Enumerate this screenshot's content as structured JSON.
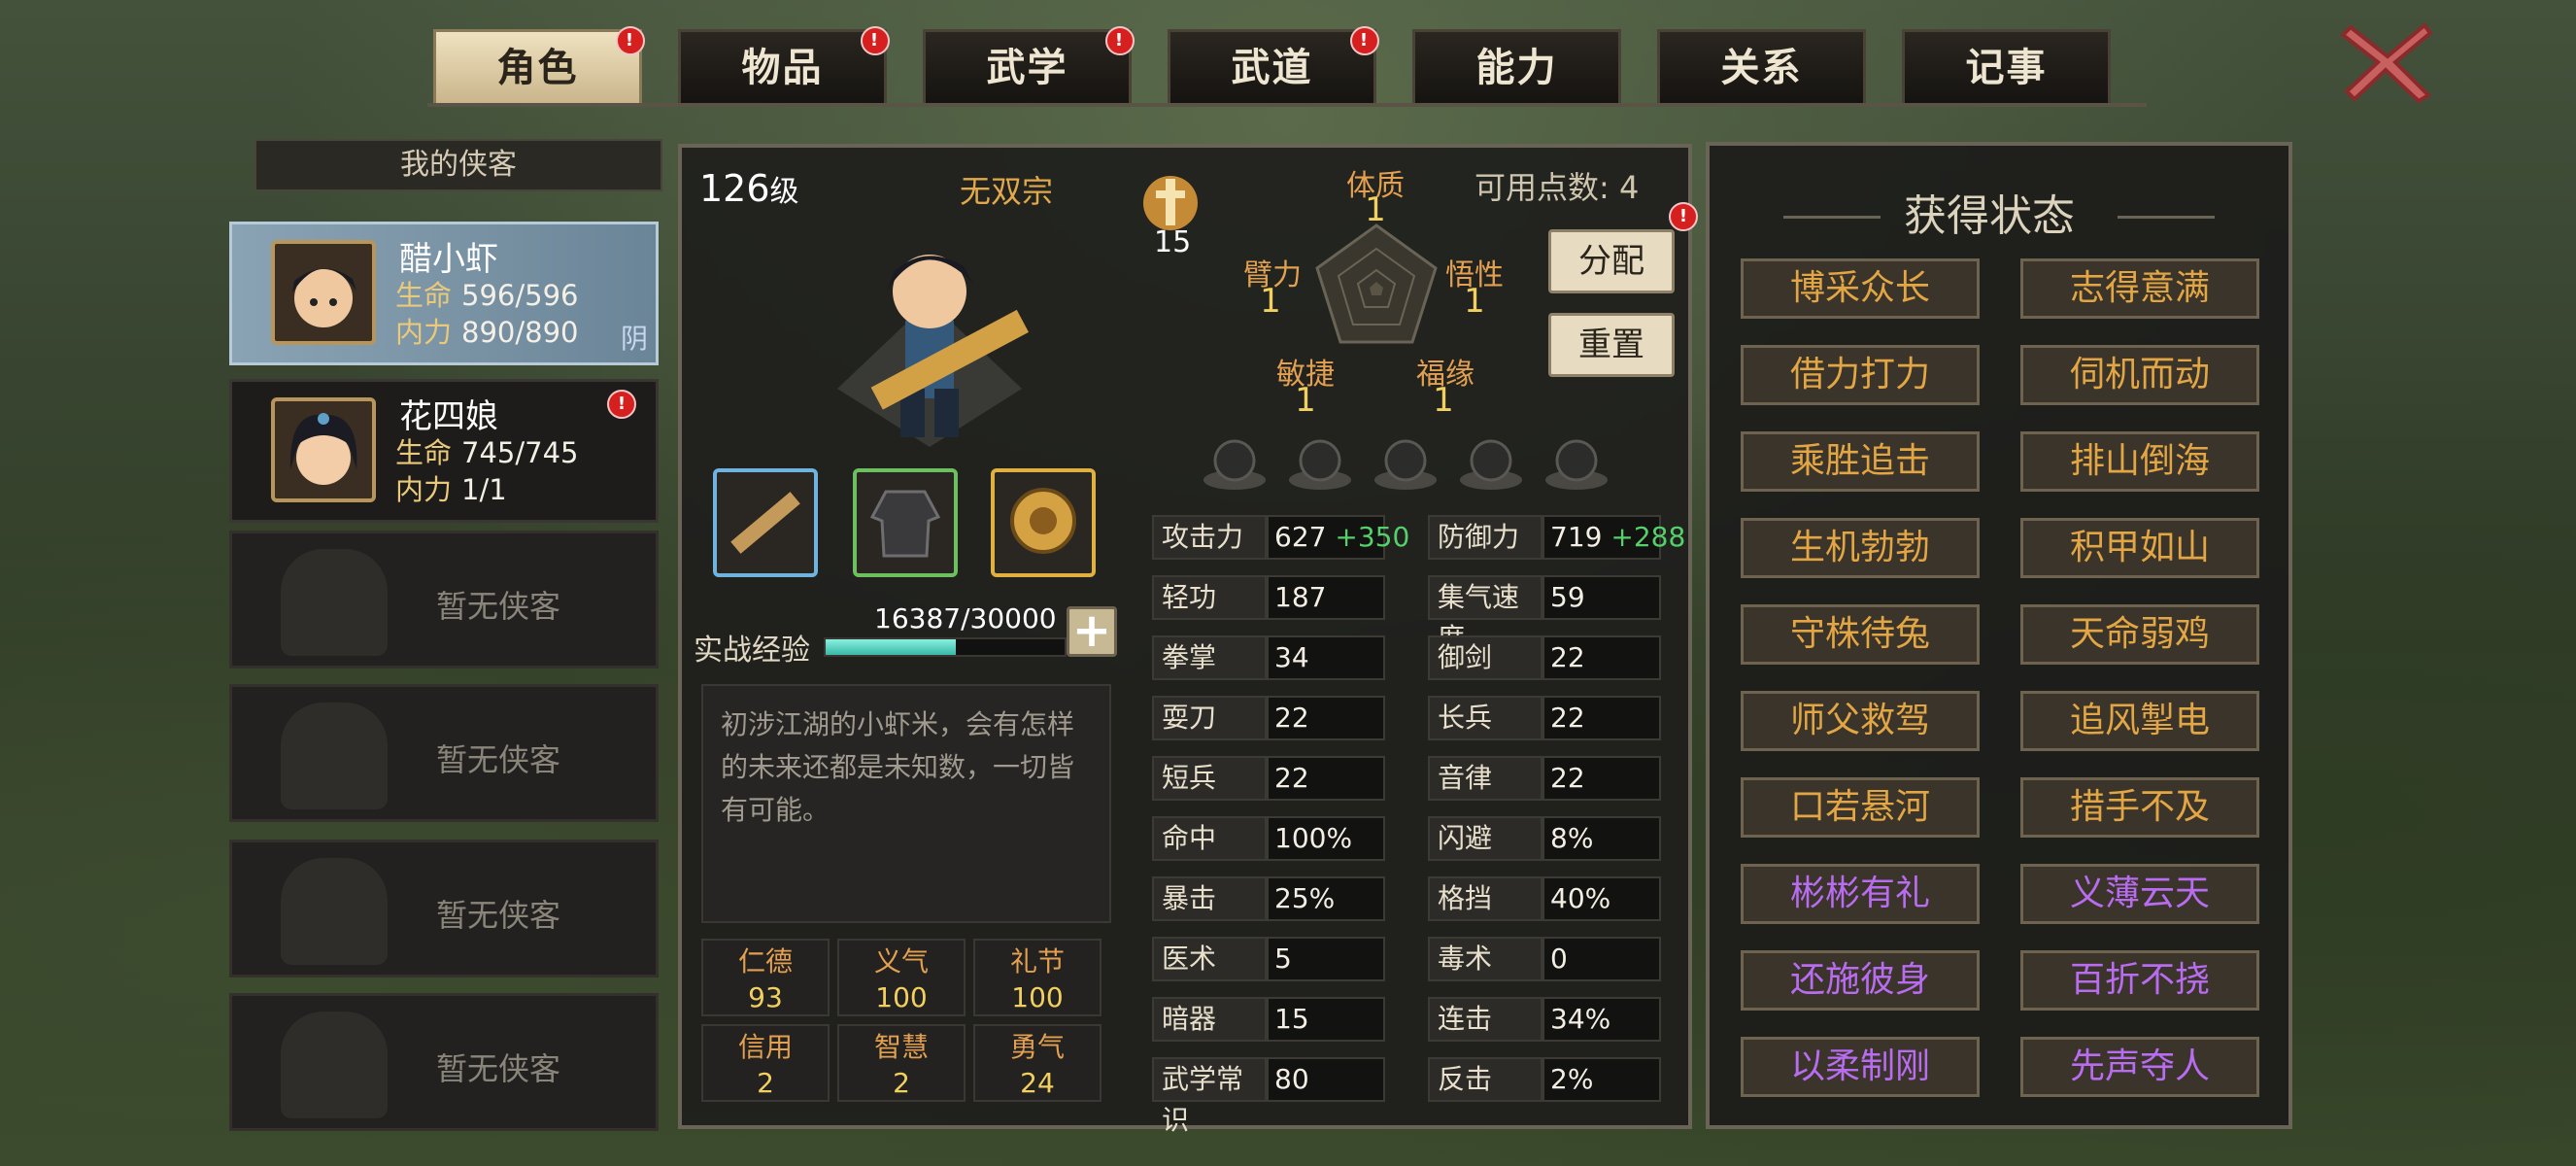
{
  "tabs": [
    {
      "label": "角色",
      "active": true,
      "alert": true
    },
    {
      "label": "物品",
      "active": false,
      "alert": true
    },
    {
      "label": "武学",
      "active": false,
      "alert": true
    },
    {
      "label": "武道",
      "active": false,
      "alert": true
    },
    {
      "label": "能力",
      "active": false,
      "alert": false
    },
    {
      "label": "关系",
      "active": false,
      "alert": false
    },
    {
      "label": "记事",
      "active": false,
      "alert": false
    }
  ],
  "alert_glyph": "!",
  "list_header": "我的侠客",
  "characters": [
    {
      "name": "醋小虾",
      "hp_label": "生命",
      "hp": "596/596",
      "mp_label": "内力",
      "mp": "890/890",
      "tag": "阴"
    },
    {
      "name": "花四娘",
      "hp_label": "生命",
      "hp": "745/745",
      "mp_label": "内力",
      "mp": "1/1"
    }
  ],
  "empty_slot": "暂无侠客",
  "profile": {
    "level": "126",
    "level_unit": "级",
    "sect": "无双宗",
    "count": "15",
    "points_label": "可用点数: 4",
    "attrs": {
      "tizhi": "体质",
      "tizhi_v": "1",
      "bili": "臂力",
      "bili_v": "1",
      "wuxing": "悟性",
      "wuxing_v": "1",
      "minjie": "敏捷",
      "minjie_v": "1",
      "fuyuan": "福缘",
      "fuyuan_v": "1"
    },
    "assign_btn": "分配",
    "reset_btn": "重置",
    "exp_label": "实战经验",
    "exp_value": "16387/30000",
    "exp_ratio": 0.546,
    "plus": "+",
    "description": "初涉江湖的小虾米，会有怎样的未来还都是未知数，一切皆有可能。"
  },
  "virtues": [
    {
      "label": "仁德",
      "value": "93"
    },
    {
      "label": "义气",
      "value": "100"
    },
    {
      "label": "礼节",
      "value": "100"
    },
    {
      "label": "信用",
      "value": "2"
    },
    {
      "label": "智慧",
      "value": "2"
    },
    {
      "label": "勇气",
      "value": "24"
    }
  ],
  "stats_left": [
    {
      "label": "攻击力",
      "value": "627",
      "bonus": "+350"
    },
    {
      "label": "轻功",
      "value": "187"
    },
    {
      "label": "拳掌",
      "value": "34"
    },
    {
      "label": "耍刀",
      "value": "22"
    },
    {
      "label": "短兵",
      "value": "22"
    },
    {
      "label": "命中",
      "value": "100%"
    },
    {
      "label": "暴击",
      "value": "25%"
    },
    {
      "label": "医术",
      "value": "5"
    },
    {
      "label": "暗器",
      "value": "15"
    },
    {
      "label": "武学常识",
      "value": "80"
    }
  ],
  "stats_right": [
    {
      "label": "防御力",
      "value": "719",
      "bonus": "+288"
    },
    {
      "label": "集气速度",
      "value": "59"
    },
    {
      "label": "御剑",
      "value": "22"
    },
    {
      "label": "长兵",
      "value": "22"
    },
    {
      "label": "音律",
      "value": "22"
    },
    {
      "label": "闪避",
      "value": "8%"
    },
    {
      "label": "格挡",
      "value": "40%"
    },
    {
      "label": "毒术",
      "value": "0"
    },
    {
      "label": "连击",
      "value": "34%"
    },
    {
      "label": "反击",
      "value": "2%"
    }
  ],
  "status_title": "获得状态",
  "statuses": [
    {
      "label": "博采众长",
      "color": "gold"
    },
    {
      "label": "志得意满",
      "color": "gold"
    },
    {
      "label": "借力打力",
      "color": "gold"
    },
    {
      "label": "伺机而动",
      "color": "gold"
    },
    {
      "label": "乘胜追击",
      "color": "gold"
    },
    {
      "label": "排山倒海",
      "color": "gold"
    },
    {
      "label": "生机勃勃",
      "color": "gold"
    },
    {
      "label": "积甲如山",
      "color": "gold"
    },
    {
      "label": "守株待兔",
      "color": "gold"
    },
    {
      "label": "天命弱鸡",
      "color": "gold"
    },
    {
      "label": "师父救驾",
      "color": "gold"
    },
    {
      "label": "追风掣电",
      "color": "gold"
    },
    {
      "label": "口若悬河",
      "color": "gold"
    },
    {
      "label": "措手不及",
      "color": "gold"
    },
    {
      "label": "彬彬有礼",
      "color": "purple"
    },
    {
      "label": "义薄云天",
      "color": "purple"
    },
    {
      "label": "还施彼身",
      "color": "purple"
    },
    {
      "label": "百折不挠",
      "color": "purple"
    },
    {
      "label": "以柔制刚",
      "color": "purple"
    },
    {
      "label": "先声夺人",
      "color": "purple"
    }
  ],
  "colors": {
    "gold": "#e3a645",
    "purple": "#b86cf0",
    "bonus": "#55d06a"
  }
}
